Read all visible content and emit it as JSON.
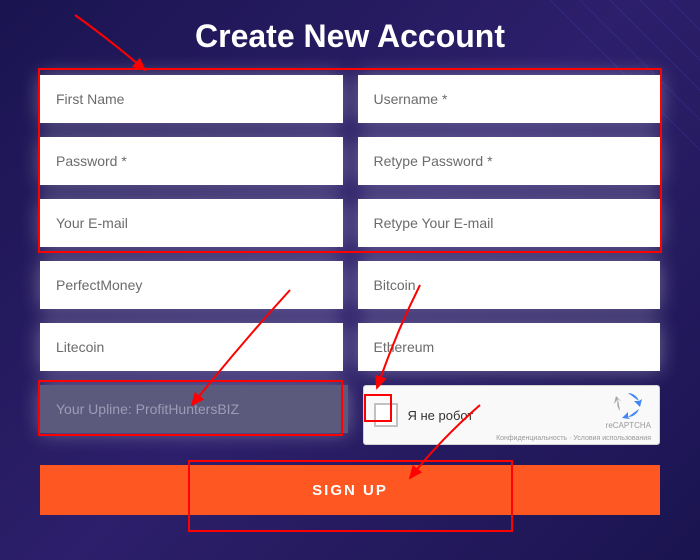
{
  "title": "Create New Account",
  "fields": {
    "first_name": {
      "placeholder": "First Name",
      "value": ""
    },
    "username": {
      "placeholder": "Username *",
      "value": ""
    },
    "password": {
      "placeholder": "Password *",
      "value": ""
    },
    "retype_password": {
      "placeholder": "Retype Password *",
      "value": ""
    },
    "email": {
      "placeholder": "Your E-mail",
      "value": ""
    },
    "retype_email": {
      "placeholder": "Retype Your E-mail",
      "value": ""
    },
    "perfectmoney": {
      "placeholder": "PerfectMoney",
      "value": ""
    },
    "bitcoin": {
      "placeholder": "Bitcoin",
      "value": ""
    },
    "litecoin": {
      "placeholder": "Litecoin",
      "value": ""
    },
    "ethereum": {
      "placeholder": "Ethereum",
      "value": ""
    },
    "upline": {
      "value": "Your Upline: ProfitHuntersBIZ"
    }
  },
  "recaptcha": {
    "label": "Я не робот",
    "brand": "reCAPTCHA",
    "footer": "Конфиденциальность · Условия использования"
  },
  "buttons": {
    "signup": "SIGN UP"
  }
}
